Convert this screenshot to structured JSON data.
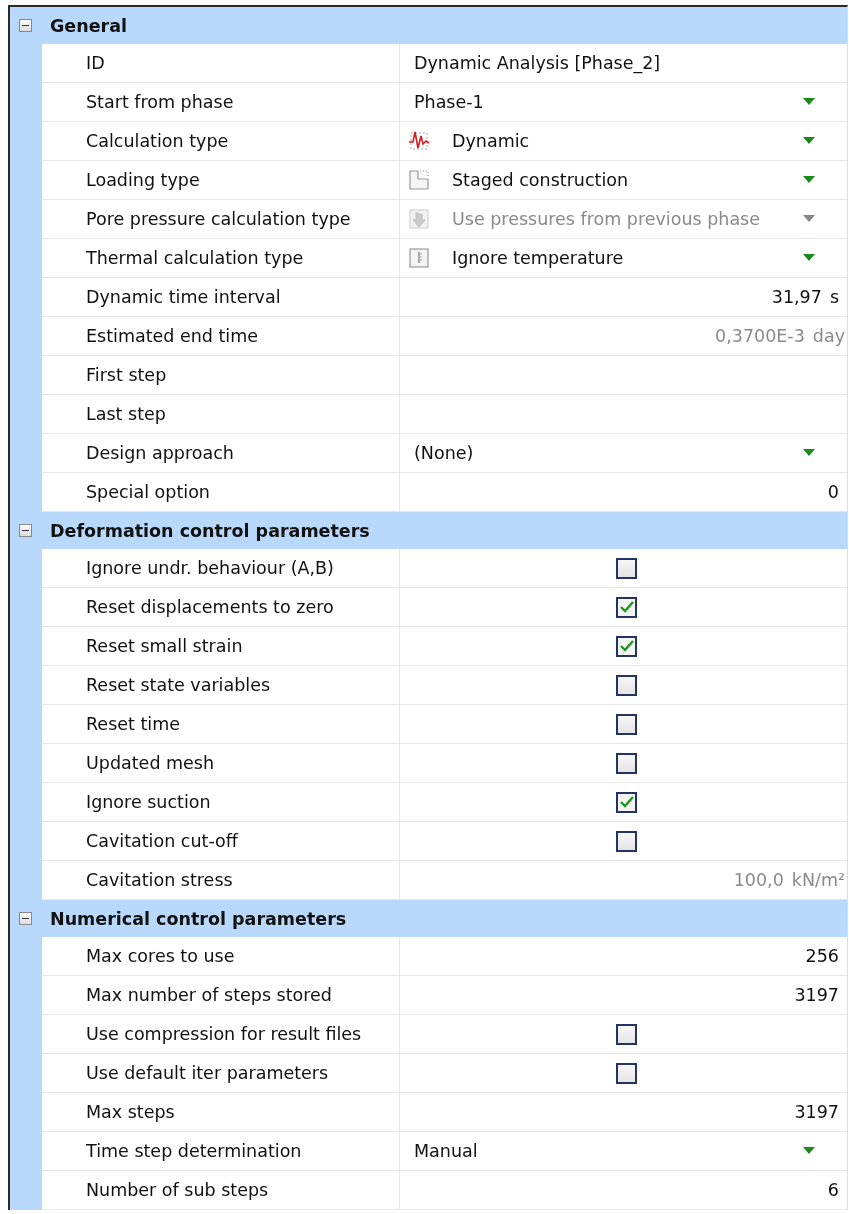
{
  "sections": [
    {
      "title": "General",
      "expanded": true,
      "rows": [
        {
          "label": "ID",
          "kind": "text",
          "value": "Dynamic Analysis [Phase_2]"
        },
        {
          "label": "Start from phase",
          "kind": "dropdown",
          "value": "Phase-1",
          "disabled": false
        },
        {
          "label": "Calculation type",
          "kind": "dropdown",
          "value": "Dynamic",
          "disabled": false
        },
        {
          "label": "Loading type",
          "kind": "dropdown",
          "value": "Staged construction",
          "disabled": false
        },
        {
          "label": "Pore pressure calculation type",
          "kind": "dropdown",
          "value": "Use pressures from previous phase",
          "disabled": true
        },
        {
          "label": "Thermal calculation type",
          "kind": "dropdown",
          "value": "Ignore temperature",
          "disabled": false
        },
        {
          "label": "Dynamic time interval",
          "kind": "number",
          "value": "31,97",
          "unit": "s",
          "disabled": false
        },
        {
          "label": "Estimated end time",
          "kind": "number",
          "value": "0,3700E-3",
          "unit": "day",
          "disabled": true
        },
        {
          "label": "First step",
          "kind": "text"
        },
        {
          "label": "Last step",
          "kind": "text"
        },
        {
          "label": "Design approach",
          "kind": "dropdown",
          "value": "(None)",
          "disabled": false
        },
        {
          "label": "Special option",
          "kind": "number",
          "value": "0",
          "disabled": false
        }
      ]
    },
    {
      "title": "Deformation control parameters",
      "expanded": true,
      "rows": [
        {
          "label": "Ignore undr. behaviour (A,B)",
          "kind": "checkbox",
          "checked": false
        },
        {
          "label": "Reset displacements to zero",
          "kind": "checkbox",
          "checked": true
        },
        {
          "label": "Reset small strain",
          "kind": "checkbox",
          "checked": true
        },
        {
          "label": "Reset state variables",
          "kind": "checkbox",
          "checked": false
        },
        {
          "label": "Reset time",
          "kind": "checkbox",
          "checked": false
        },
        {
          "label": "Updated mesh",
          "kind": "checkbox",
          "checked": false
        },
        {
          "label": "Ignore suction",
          "kind": "checkbox",
          "checked": true
        },
        {
          "label": "Cavitation cut-off",
          "kind": "checkbox",
          "checked": false
        },
        {
          "label": "Cavitation stress",
          "kind": "number",
          "value": "100,0",
          "unit": "kN/m²",
          "disabled": true
        }
      ]
    },
    {
      "title": "Numerical control parameters",
      "expanded": true,
      "rows": [
        {
          "label": "Max cores to use",
          "kind": "number",
          "value": "256",
          "disabled": false
        },
        {
          "label": "Max number of steps stored",
          "kind": "number",
          "value": "3197",
          "disabled": false
        },
        {
          "label": "Use compression for result files",
          "kind": "checkbox",
          "checked": false
        },
        {
          "label": "Use default iter parameters",
          "kind": "checkbox",
          "checked": false
        },
        {
          "label": "Max steps",
          "kind": "number",
          "value": "3197",
          "disabled": false
        },
        {
          "label": "Time step determination",
          "kind": "dropdown",
          "value": "Manual",
          "disabled": false
        },
        {
          "label": "Number of sub steps",
          "kind": "number",
          "value": "6",
          "disabled": false
        }
      ]
    }
  ]
}
